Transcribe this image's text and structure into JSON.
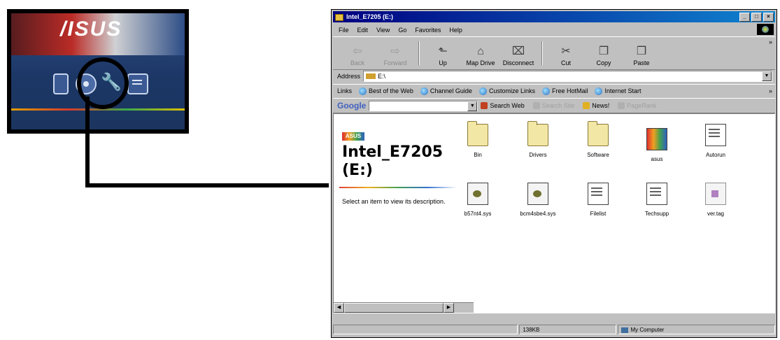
{
  "inset": {
    "logo": "/ISUS",
    "buttons": [
      "drivers-button",
      "cd-button",
      "tools-button",
      "info-button"
    ]
  },
  "window": {
    "title": "Intel_E7205 (E:)",
    "title_buttons": [
      "_",
      "□",
      "×"
    ],
    "menu": [
      "File",
      "Edit",
      "View",
      "Go",
      "Favorites",
      "Help"
    ],
    "toolbar": [
      {
        "label": "Back",
        "icon": "back-arrow-icon",
        "glyph": "⇦",
        "disabled": true
      },
      {
        "label": "Forward",
        "icon": "forward-arrow-icon",
        "glyph": "⇨",
        "disabled": true
      },
      {
        "label": "Up",
        "icon": "up-folder-icon",
        "glyph": "⬑",
        "disabled": false
      },
      {
        "label": "Map Drive",
        "icon": "map-drive-icon",
        "glyph": "⌂",
        "disabled": false
      },
      {
        "label": "Disconnect",
        "icon": "disconnect-icon",
        "glyph": "⌧",
        "disabled": false
      },
      {
        "label": "Cut",
        "icon": "cut-icon",
        "glyph": "✂",
        "disabled": false
      },
      {
        "label": "Copy",
        "icon": "copy-icon",
        "glyph": "❐",
        "disabled": false
      },
      {
        "label": "Paste",
        "icon": "paste-icon",
        "glyph": "❒",
        "disabled": false
      }
    ],
    "address": {
      "label": "Address",
      "value": "E:\\"
    },
    "links": {
      "label": "Links",
      "items": [
        "Best of the Web",
        "Channel Guide",
        "Customize Links",
        "Free HotMail",
        "Internet Start"
      ]
    },
    "google": {
      "logo": "Google",
      "search_web": "Search Web",
      "search_site": "Search Site",
      "news": "News!",
      "pagerank": "PageRank"
    },
    "left_panel": {
      "logo": "ASUS",
      "title": "Intel_E7205 (E:)",
      "description": "Select an item to view its description."
    },
    "files": [
      {
        "name": "Bin",
        "type": "folder"
      },
      {
        "name": "Drivers",
        "type": "folder"
      },
      {
        "name": "Software",
        "type": "folder"
      },
      {
        "name": "asus",
        "type": "exe"
      },
      {
        "name": "Autorun",
        "type": "doc"
      },
      {
        "name": "b57nt4.sys",
        "type": "sys"
      },
      {
        "name": "bcm4sbe4.sys",
        "type": "sys"
      },
      {
        "name": "Filelist",
        "type": "doc"
      },
      {
        "name": "Techsupp",
        "type": "doc"
      },
      {
        "name": "ver.tag",
        "type": "tag"
      }
    ],
    "status": {
      "size": "138KB",
      "location": "My Computer"
    }
  }
}
